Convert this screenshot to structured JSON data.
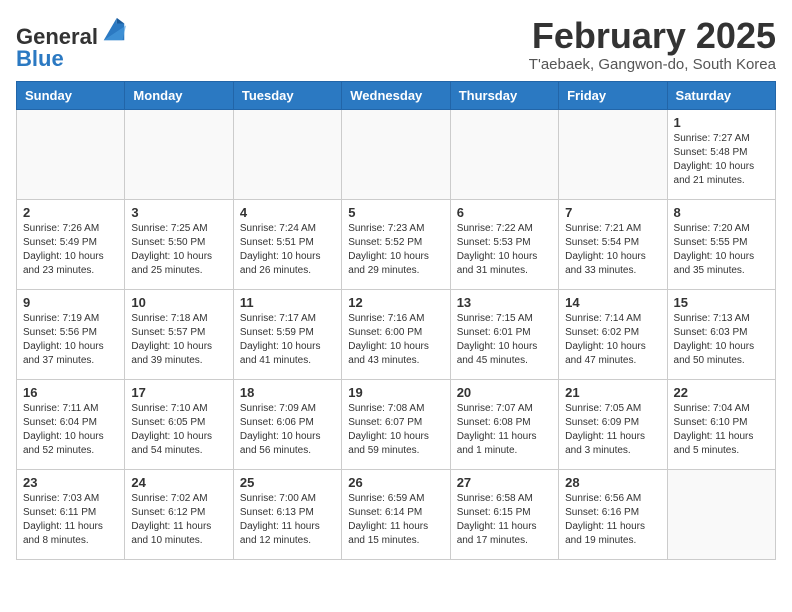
{
  "logo": {
    "general": "General",
    "blue": "Blue"
  },
  "title": "February 2025",
  "subtitle": "T'aebaek, Gangwon-do, South Korea",
  "days_of_week": [
    "Sunday",
    "Monday",
    "Tuesday",
    "Wednesday",
    "Thursday",
    "Friday",
    "Saturday"
  ],
  "weeks": [
    [
      {
        "day": "",
        "info": ""
      },
      {
        "day": "",
        "info": ""
      },
      {
        "day": "",
        "info": ""
      },
      {
        "day": "",
        "info": ""
      },
      {
        "day": "",
        "info": ""
      },
      {
        "day": "",
        "info": ""
      },
      {
        "day": "1",
        "info": "Sunrise: 7:27 AM\nSunset: 5:48 PM\nDaylight: 10 hours and 21 minutes."
      }
    ],
    [
      {
        "day": "2",
        "info": "Sunrise: 7:26 AM\nSunset: 5:49 PM\nDaylight: 10 hours and 23 minutes."
      },
      {
        "day": "3",
        "info": "Sunrise: 7:25 AM\nSunset: 5:50 PM\nDaylight: 10 hours and 25 minutes."
      },
      {
        "day": "4",
        "info": "Sunrise: 7:24 AM\nSunset: 5:51 PM\nDaylight: 10 hours and 26 minutes."
      },
      {
        "day": "5",
        "info": "Sunrise: 7:23 AM\nSunset: 5:52 PM\nDaylight: 10 hours and 29 minutes."
      },
      {
        "day": "6",
        "info": "Sunrise: 7:22 AM\nSunset: 5:53 PM\nDaylight: 10 hours and 31 minutes."
      },
      {
        "day": "7",
        "info": "Sunrise: 7:21 AM\nSunset: 5:54 PM\nDaylight: 10 hours and 33 minutes."
      },
      {
        "day": "8",
        "info": "Sunrise: 7:20 AM\nSunset: 5:55 PM\nDaylight: 10 hours and 35 minutes."
      }
    ],
    [
      {
        "day": "9",
        "info": "Sunrise: 7:19 AM\nSunset: 5:56 PM\nDaylight: 10 hours and 37 minutes."
      },
      {
        "day": "10",
        "info": "Sunrise: 7:18 AM\nSunset: 5:57 PM\nDaylight: 10 hours and 39 minutes."
      },
      {
        "day": "11",
        "info": "Sunrise: 7:17 AM\nSunset: 5:59 PM\nDaylight: 10 hours and 41 minutes."
      },
      {
        "day": "12",
        "info": "Sunrise: 7:16 AM\nSunset: 6:00 PM\nDaylight: 10 hours and 43 minutes."
      },
      {
        "day": "13",
        "info": "Sunrise: 7:15 AM\nSunset: 6:01 PM\nDaylight: 10 hours and 45 minutes."
      },
      {
        "day": "14",
        "info": "Sunrise: 7:14 AM\nSunset: 6:02 PM\nDaylight: 10 hours and 47 minutes."
      },
      {
        "day": "15",
        "info": "Sunrise: 7:13 AM\nSunset: 6:03 PM\nDaylight: 10 hours and 50 minutes."
      }
    ],
    [
      {
        "day": "16",
        "info": "Sunrise: 7:11 AM\nSunset: 6:04 PM\nDaylight: 10 hours and 52 minutes."
      },
      {
        "day": "17",
        "info": "Sunrise: 7:10 AM\nSunset: 6:05 PM\nDaylight: 10 hours and 54 minutes."
      },
      {
        "day": "18",
        "info": "Sunrise: 7:09 AM\nSunset: 6:06 PM\nDaylight: 10 hours and 56 minutes."
      },
      {
        "day": "19",
        "info": "Sunrise: 7:08 AM\nSunset: 6:07 PM\nDaylight: 10 hours and 59 minutes."
      },
      {
        "day": "20",
        "info": "Sunrise: 7:07 AM\nSunset: 6:08 PM\nDaylight: 11 hours and 1 minute."
      },
      {
        "day": "21",
        "info": "Sunrise: 7:05 AM\nSunset: 6:09 PM\nDaylight: 11 hours and 3 minutes."
      },
      {
        "day": "22",
        "info": "Sunrise: 7:04 AM\nSunset: 6:10 PM\nDaylight: 11 hours and 5 minutes."
      }
    ],
    [
      {
        "day": "23",
        "info": "Sunrise: 7:03 AM\nSunset: 6:11 PM\nDaylight: 11 hours and 8 minutes."
      },
      {
        "day": "24",
        "info": "Sunrise: 7:02 AM\nSunset: 6:12 PM\nDaylight: 11 hours and 10 minutes."
      },
      {
        "day": "25",
        "info": "Sunrise: 7:00 AM\nSunset: 6:13 PM\nDaylight: 11 hours and 12 minutes."
      },
      {
        "day": "26",
        "info": "Sunrise: 6:59 AM\nSunset: 6:14 PM\nDaylight: 11 hours and 15 minutes."
      },
      {
        "day": "27",
        "info": "Sunrise: 6:58 AM\nSunset: 6:15 PM\nDaylight: 11 hours and 17 minutes."
      },
      {
        "day": "28",
        "info": "Sunrise: 6:56 AM\nSunset: 6:16 PM\nDaylight: 11 hours and 19 minutes."
      },
      {
        "day": "",
        "info": ""
      }
    ]
  ]
}
